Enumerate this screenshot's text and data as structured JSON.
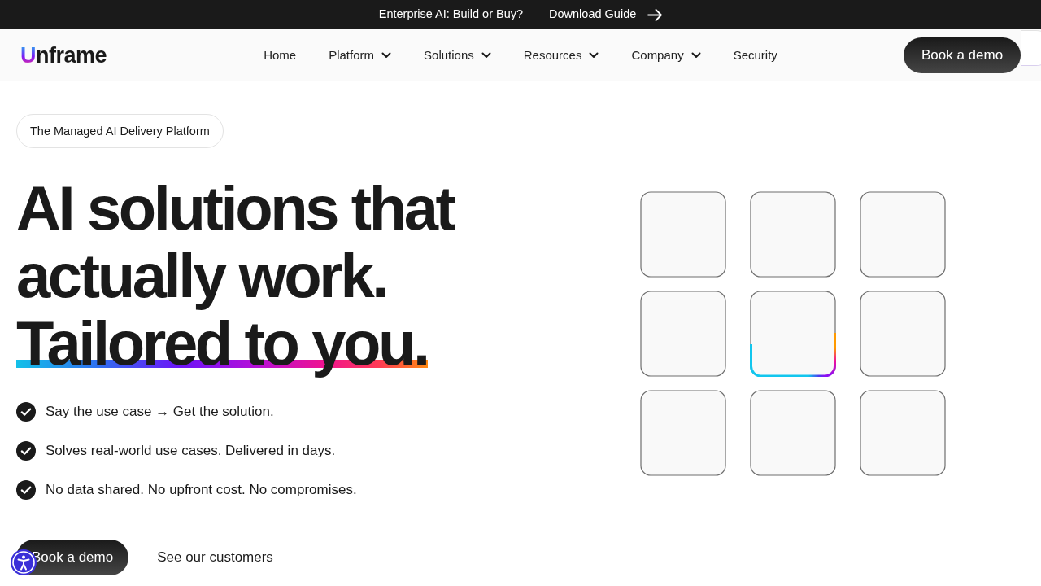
{
  "announcement_bar": {
    "text": "Enterprise AI: Build or Buy?",
    "link": "Download Guide"
  },
  "navbar": {
    "logo": "Unframe",
    "items": [
      {
        "label": "Home",
        "dropdown": false
      },
      {
        "label": "Platform",
        "dropdown": true
      },
      {
        "label": "Solutions",
        "dropdown": true
      },
      {
        "label": "Resources",
        "dropdown": true
      },
      {
        "label": "Company",
        "dropdown": true
      },
      {
        "label": "Security",
        "dropdown": false
      }
    ],
    "button": "Book a demo"
  },
  "hero": {
    "badge": "The Managed AI Delivery Platform",
    "headline": [
      {
        "text": "AI solutions that",
        "underlined": false
      },
      {
        "text": "actually work.",
        "underlined": false
      },
      {
        "text": "Tailored to you.",
        "underlined": true
      }
    ],
    "features": [
      "Say the use case → Get the solution.",
      "Solves real-world use cases. Delivered in days.",
      "No data shared. No upfront cost. No compromises."
    ],
    "primary_button": "Book a demo",
    "secondary_link": "See our customers",
    "tiles": [
      {
        "highlighted": false
      },
      {
        "highlighted": false
      },
      {
        "highlighted": false
      },
      {
        "highlighted": false
      },
      {
        "highlighted": true
      },
      {
        "highlighted": false
      },
      {
        "highlighted": false
      },
      {
        "highlighted": false
      },
      {
        "highlighted": false
      }
    ]
  }
}
